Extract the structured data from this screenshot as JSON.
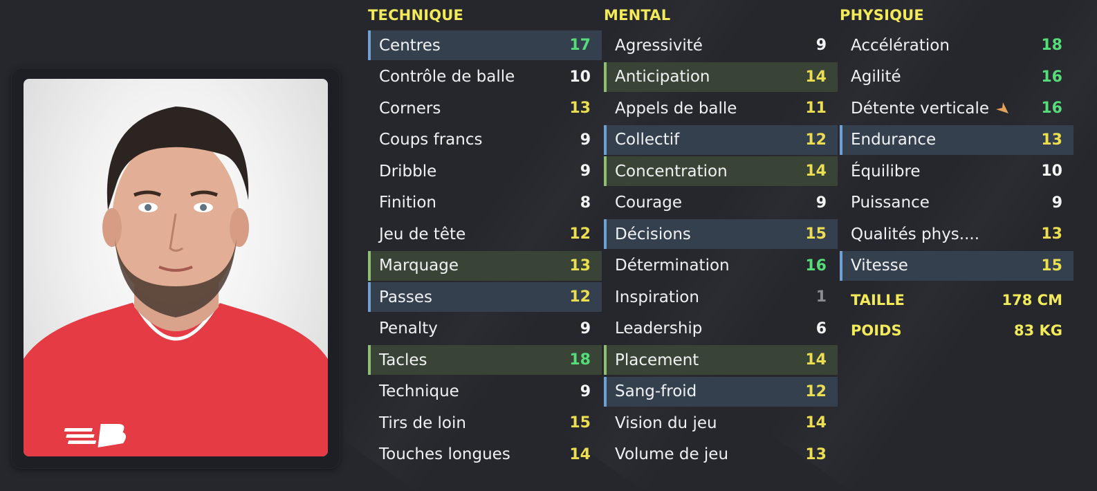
{
  "portrait": {
    "description_icon": "player-portrait"
  },
  "technique": {
    "title": "TECHNIQUE",
    "rows": [
      {
        "label": "Centres",
        "value": "17",
        "color": "green",
        "hl": "blue"
      },
      {
        "label": "Contrôle de balle",
        "value": "10",
        "color": "white",
        "hl": ""
      },
      {
        "label": "Corners",
        "value": "13",
        "color": "yellow",
        "hl": ""
      },
      {
        "label": "Coups francs",
        "value": "9",
        "color": "white",
        "hl": ""
      },
      {
        "label": "Dribble",
        "value": "9",
        "color": "white",
        "hl": ""
      },
      {
        "label": "Finition",
        "value": "8",
        "color": "white",
        "hl": ""
      },
      {
        "label": "Jeu de tête",
        "value": "12",
        "color": "yellow",
        "hl": ""
      },
      {
        "label": "Marquage",
        "value": "13",
        "color": "yellow",
        "hl": "green"
      },
      {
        "label": "Passes",
        "value": "12",
        "color": "yellow",
        "hl": "blue"
      },
      {
        "label": "Penalty",
        "value": "9",
        "color": "white",
        "hl": ""
      },
      {
        "label": "Tacles",
        "value": "18",
        "color": "green",
        "hl": "green"
      },
      {
        "label": "Technique",
        "value": "9",
        "color": "white",
        "hl": ""
      },
      {
        "label": "Tirs de loin",
        "value": "15",
        "color": "yellow",
        "hl": ""
      },
      {
        "label": "Touches longues",
        "value": "14",
        "color": "yellow",
        "hl": ""
      }
    ]
  },
  "mental": {
    "title": "MENTAL",
    "rows": [
      {
        "label": "Agressivité",
        "value": "9",
        "color": "white",
        "hl": ""
      },
      {
        "label": "Anticipation",
        "value": "14",
        "color": "yellow",
        "hl": "green"
      },
      {
        "label": "Appels de balle",
        "value": "11",
        "color": "yellow",
        "hl": ""
      },
      {
        "label": "Collectif",
        "value": "12",
        "color": "yellow",
        "hl": "blue"
      },
      {
        "label": "Concentration",
        "value": "14",
        "color": "yellow",
        "hl": "green"
      },
      {
        "label": "Courage",
        "value": "9",
        "color": "white",
        "hl": ""
      },
      {
        "label": "Décisions",
        "value": "15",
        "color": "yellow",
        "hl": "blue"
      },
      {
        "label": "Détermination",
        "value": "16",
        "color": "green",
        "hl": ""
      },
      {
        "label": "Inspiration",
        "value": "1",
        "color": "gray",
        "hl": ""
      },
      {
        "label": "Leadership",
        "value": "6",
        "color": "white",
        "hl": ""
      },
      {
        "label": "Placement",
        "value": "14",
        "color": "yellow",
        "hl": "green"
      },
      {
        "label": "Sang-froid",
        "value": "12",
        "color": "yellow",
        "hl": "blue"
      },
      {
        "label": "Vision du jeu",
        "value": "14",
        "color": "yellow",
        "hl": ""
      },
      {
        "label": "Volume de jeu",
        "value": "13",
        "color": "yellow",
        "hl": ""
      }
    ]
  },
  "physique": {
    "title": "PHYSIQUE",
    "rows": [
      {
        "label": "Accélération",
        "value": "18",
        "color": "green",
        "hl": ""
      },
      {
        "label": "Agilité",
        "value": "16",
        "color": "green",
        "hl": ""
      },
      {
        "label": "Détente verticale",
        "value": "16",
        "color": "green",
        "hl": "",
        "icon": "trend-up-arrow-icon"
      },
      {
        "label": "Endurance",
        "value": "13",
        "color": "yellow",
        "hl": "blue"
      },
      {
        "label": "Équilibre",
        "value": "10",
        "color": "white",
        "hl": ""
      },
      {
        "label": "Puissance",
        "value": "9",
        "color": "white",
        "hl": ""
      },
      {
        "label": "Qualités phys....",
        "value": "13",
        "color": "yellow",
        "hl": ""
      },
      {
        "label": "Vitesse",
        "value": "15",
        "color": "yellow",
        "hl": "blue"
      }
    ],
    "info": [
      {
        "label": "TAILLE",
        "value": "178 CM"
      },
      {
        "label": "POIDS",
        "value": "83 KG"
      }
    ]
  },
  "colors": {
    "yellow": "#ecde52",
    "green": "#57dc7a",
    "white": "#f4f4f4",
    "gray": "#8a8c92",
    "highlight_blue": "#35404e",
    "highlight_green": "#394437"
  }
}
